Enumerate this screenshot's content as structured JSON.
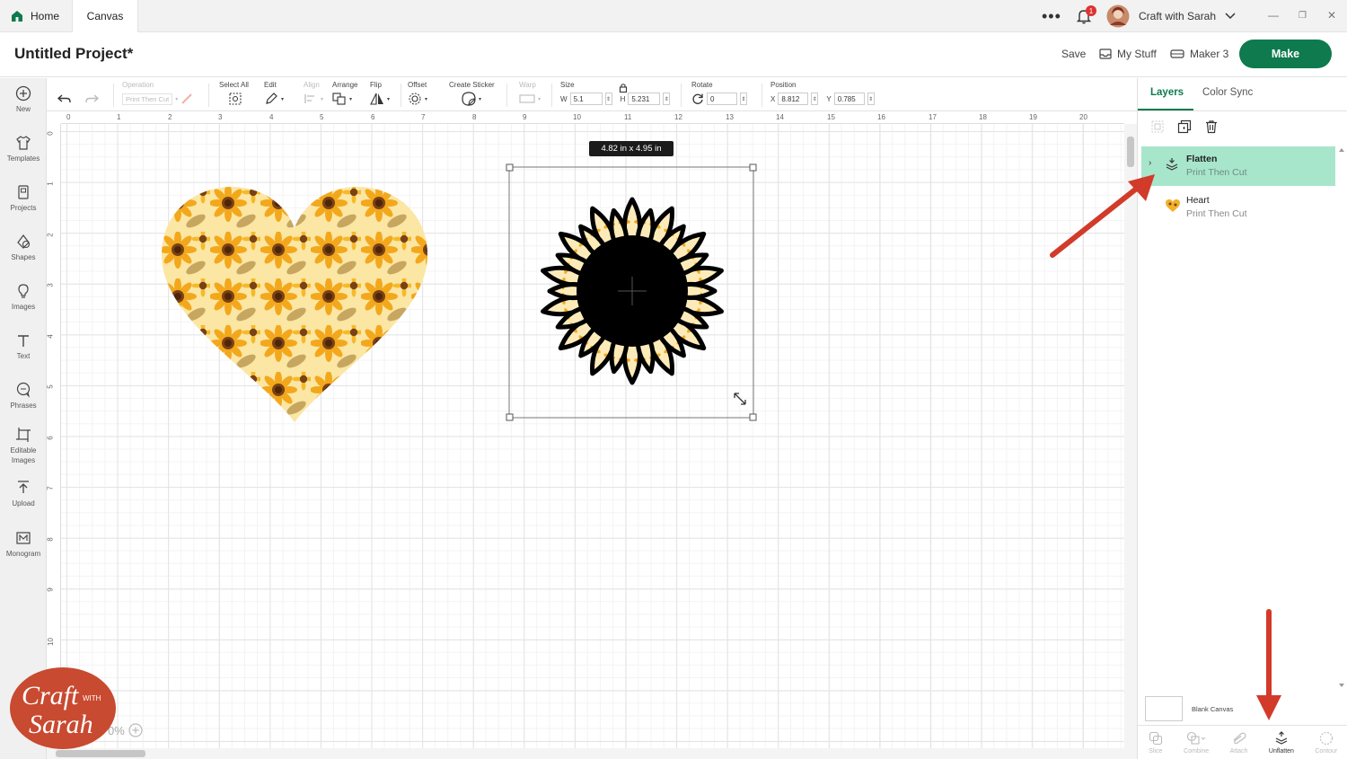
{
  "tabs": {
    "home": "Home",
    "canvas": "Canvas"
  },
  "topbar": {
    "notification_count": "1",
    "user_name": "Craft with Sarah"
  },
  "header": {
    "project_title": "Untitled Project*",
    "save": "Save",
    "my_stuff": "My Stuff",
    "machine": "Maker 3",
    "make": "Make"
  },
  "sidebar": {
    "items": [
      {
        "label": "New"
      },
      {
        "label": "Templates"
      },
      {
        "label": "Projects"
      },
      {
        "label": "Shapes"
      },
      {
        "label": "Images"
      },
      {
        "label": "Text"
      },
      {
        "label": "Phrases"
      },
      {
        "label": "Editable Images"
      },
      {
        "label": "Upload"
      },
      {
        "label": "Monogram"
      }
    ]
  },
  "toolbar": {
    "operation_label": "Operation",
    "operation_value": "Print Then Cut",
    "select_all": "Select All",
    "edit": "Edit",
    "align": "Align",
    "arrange": "Arrange",
    "flip": "Flip",
    "offset": "Offset",
    "create_sticker": "Create Sticker",
    "warp": "Warp",
    "size": "Size",
    "w_label": "W",
    "w_value": "5.1",
    "h_label": "H",
    "h_value": "5.231",
    "rotate": "Rotate",
    "rotate_value": "0",
    "position": "Position",
    "x_label": "X",
    "x_value": "8.812",
    "y_label": "Y",
    "y_value": "0.785"
  },
  "ruler": {
    "top": [
      "0",
      "1",
      "2",
      "3",
      "4",
      "5",
      "6",
      "7",
      "8",
      "9",
      "10",
      "11",
      "12",
      "13",
      "14",
      "15",
      "16",
      "17",
      "18",
      "19",
      "20"
    ],
    "left": [
      "0",
      "1",
      "2",
      "3",
      "4",
      "5",
      "6",
      "7",
      "8",
      "9",
      "10"
    ]
  },
  "canvas": {
    "size_tooltip": "4.82  in x 4.95  in"
  },
  "right_panel": {
    "tab_layers": "Layers",
    "tab_color_sync": "Color Sync",
    "layers": [
      {
        "name": "Flatten",
        "operation": "Print Then Cut",
        "selected": true
      },
      {
        "name": "Heart",
        "operation": "Print Then Cut",
        "selected": false
      }
    ],
    "blank_canvas": "Blank Canvas",
    "bottom_tools": [
      "Slice",
      "Combine",
      "Attach",
      "Unflatten",
      "Contour"
    ]
  },
  "logo": {
    "line1": "Craft",
    "with": "WITH",
    "line2": "Sarah"
  },
  "zoom_fragment": "0%",
  "colors": {
    "brand_green": "#0e7a4e",
    "selected_layer": "#a8e6cc",
    "annotation_red": "#d23a2a",
    "logo_red": "#c84a30"
  }
}
